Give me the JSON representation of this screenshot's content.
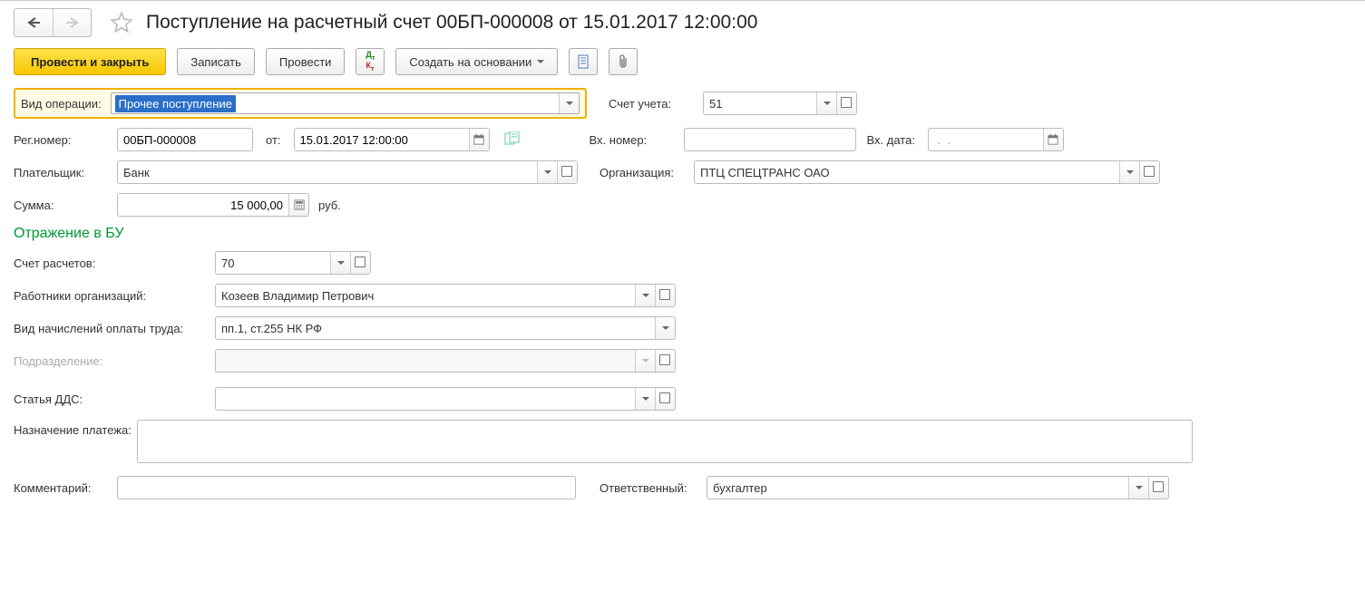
{
  "header": {
    "title": "Поступление на расчетный счет 00БП-000008 от 15.01.2017 12:00:00"
  },
  "toolbar": {
    "post_and_close": "Провести и закрыть",
    "save": "Записать",
    "post": "Провести",
    "create_based": "Создать на основании"
  },
  "labels": {
    "operation_type": "Вид операции:",
    "account": "Счет учета:",
    "reg_number": "Рег.номер:",
    "from": "от:",
    "in_number": "Вх. номер:",
    "in_date": "Вх. дата:",
    "payer": "Плательщик:",
    "organization": "Организация:",
    "sum": "Сумма:",
    "currency": "руб.",
    "section_bu": "Отражение в БУ",
    "settlement_account": "Счет расчетов:",
    "org_employees": "Работники организаций:",
    "accrual_type": "Вид начислений оплаты труда:",
    "subdivision": "Подразделение:",
    "dds_article": "Статья ДДС:",
    "payment_purpose": "Назначение платежа:",
    "comment": "Комментарий:",
    "responsible": "Ответственный:"
  },
  "values": {
    "operation_type": "Прочее поступление",
    "account": "51",
    "reg_number": "00БП-000008",
    "date": "15.01.2017 12:00:00",
    "in_number": "",
    "in_date": " .  .    ",
    "payer": "Банк",
    "organization": "ПТЦ СПЕЦТРАНС ОАО",
    "sum": "15 000,00",
    "settlement_account": "70",
    "employee": "Козеев Владимир Петрович",
    "accrual_type": "пп.1, ст.255 НК РФ",
    "subdivision": "",
    "dds_article": "",
    "payment_purpose": "",
    "comment": "",
    "responsible": "бухгалтер"
  }
}
